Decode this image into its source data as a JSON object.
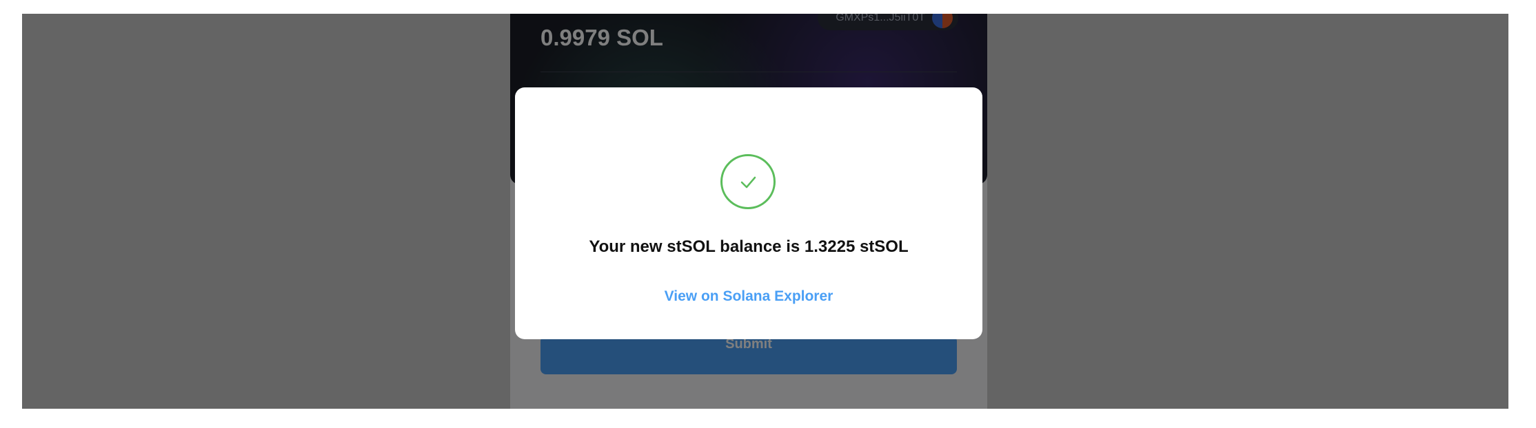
{
  "wallet": {
    "balance": "0.9979 SOL",
    "address": "GMXPs1...J5iiT0T"
  },
  "form": {
    "submit_label": "Submit"
  },
  "modal": {
    "icon": "check-circle-icon",
    "message": "Your new stSOL balance is 1.3225 stSOL",
    "link_label": "View on Solana Explorer"
  },
  "colors": {
    "accent": "#4a9ff5",
    "success": "#5bbd5b",
    "overlay": "rgba(0,0,0,0.5)"
  }
}
